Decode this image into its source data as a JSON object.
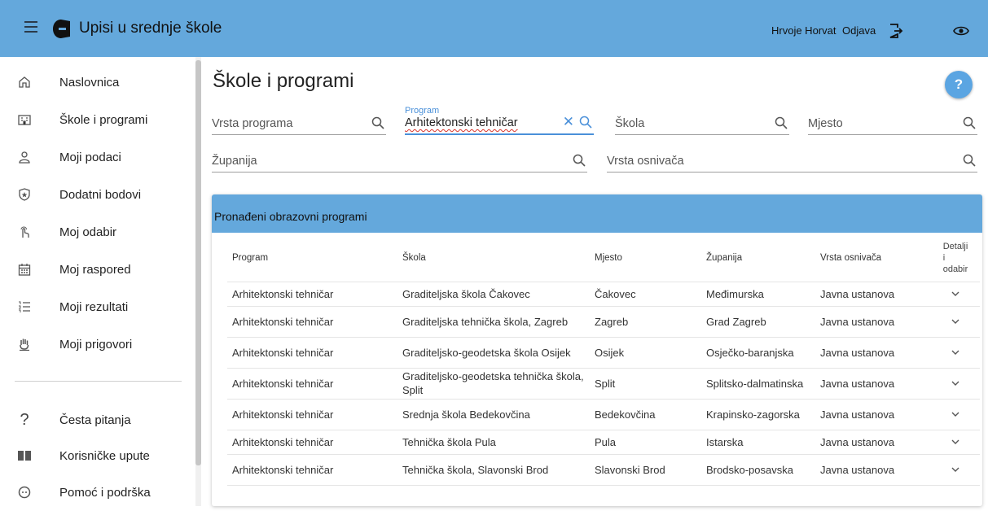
{
  "app": {
    "title": "Upisi u srednje škole",
    "user_name": "Hrvoje Horvat",
    "logout_label": "Odjava"
  },
  "colors": {
    "header_bg": "#64a8dc",
    "accent": "#4a90d9",
    "help_button": "#5ba5e2"
  },
  "sidebar": {
    "items": [
      {
        "label": "Naslovnica",
        "icon": "home-icon"
      },
      {
        "label": "Škole i programi",
        "icon": "school-building-icon"
      },
      {
        "label": "Moji podaci",
        "icon": "person-icon"
      },
      {
        "label": "Dodatni bodovi",
        "icon": "star-shield-icon"
      },
      {
        "label": "Moj odabir",
        "icon": "touch-icon"
      },
      {
        "label": "Moj raspored",
        "icon": "calendar-icon"
      },
      {
        "label": "Moji rezultati",
        "icon": "numbered-list-icon"
      },
      {
        "label": "Moji prigovori",
        "icon": "hand-icon"
      }
    ],
    "bottom_items": [
      {
        "label": "Česta pitanja",
        "icon": "question-icon"
      },
      {
        "label": "Korisničke upute",
        "icon": "book-icon"
      },
      {
        "label": "Pomoć i podrška",
        "icon": "support-icon"
      }
    ]
  },
  "page": {
    "title": "Škole i programi",
    "help_label": "?"
  },
  "filters": {
    "vrsta_programa": {
      "placeholder": "Vrsta programa"
    },
    "program": {
      "label": "Program",
      "value": "Arhitektonski tehničar"
    },
    "skola": {
      "placeholder": "Škola"
    },
    "mjesto": {
      "placeholder": "Mjesto"
    },
    "zupanija": {
      "placeholder": "Županija"
    },
    "vrsta_osnivaca": {
      "placeholder": "Vrsta osnivača"
    }
  },
  "results": {
    "title": "Pronađeni obrazovni programi",
    "headers": {
      "program": "Program",
      "skola": "Škola",
      "mjesto": "Mjesto",
      "zupanija": "Županija",
      "osnivac": "Vrsta osnivača",
      "detalji_1": "Detalji",
      "detalji_2": "i",
      "detalji_3": "odabir"
    },
    "rows": [
      {
        "program": "Arhitektonski tehničar",
        "skola": "Graditeljska škola Čakovec",
        "mjesto": "Čakovec",
        "zupanija": "Međimurska",
        "osnivac": "Javna ustanova"
      },
      {
        "program": "Arhitektonski tehničar",
        "skola": "Graditeljska tehnička škola, Zagreb",
        "mjesto": "Zagreb",
        "zupanija": "Grad Zagreb",
        "osnivac": "Javna ustanova"
      },
      {
        "program": "Arhitektonski tehničar",
        "skola": "Graditeljsko-geodetska škola Osijek",
        "mjesto": "Osijek",
        "zupanija": "Osječko-baranjska",
        "osnivac": "Javna ustanova"
      },
      {
        "program": "Arhitektonski tehničar",
        "skola": "Graditeljsko-geodetska tehnička škola, Split",
        "mjesto": "Split",
        "zupanija": "Splitsko-dalmatinska",
        "osnivac": "Javna ustanova"
      },
      {
        "program": "Arhitektonski tehničar",
        "skola": "Srednja škola Bedekovčina",
        "mjesto": "Bedekovčina",
        "zupanija": "Krapinsko-zagorska",
        "osnivac": "Javna ustanova"
      },
      {
        "program": "Arhitektonski tehničar",
        "skola": "Tehnička škola Pula",
        "mjesto": "Pula",
        "zupanija": "Istarska",
        "osnivac": "Javna ustanova"
      },
      {
        "program": "Arhitektonski tehničar",
        "skola": "Tehnička škola, Slavonski Brod",
        "mjesto": "Slavonski Brod",
        "zupanija": "Brodsko-posavska",
        "osnivac": "Javna ustanova"
      }
    ]
  }
}
